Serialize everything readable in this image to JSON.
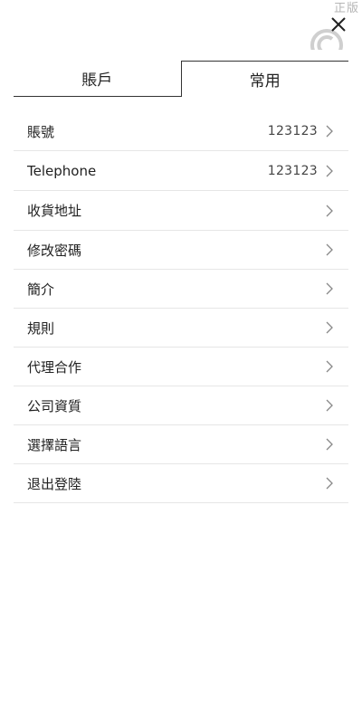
{
  "watermark": {
    "text": "正版"
  },
  "header": {
    "close_icon": "close-icon"
  },
  "tabs": [
    {
      "label": "賬戶",
      "active": false
    },
    {
      "label": "常用",
      "active": true
    }
  ],
  "menu": {
    "items": [
      {
        "label": "賬號",
        "value": "123123"
      },
      {
        "label": "Telephone",
        "value": "123123"
      },
      {
        "label": "收貨地址",
        "value": ""
      },
      {
        "label": "修改密碼",
        "value": ""
      },
      {
        "label": "簡介",
        "value": ""
      },
      {
        "label": "規則",
        "value": ""
      },
      {
        "label": "代理合作",
        "value": ""
      },
      {
        "label": "公司資質",
        "value": ""
      },
      {
        "label": "選擇語言",
        "value": ""
      },
      {
        "label": "退出登陸",
        "value": ""
      }
    ]
  },
  "colors": {
    "text": "#222222",
    "divider": "#e6e6e6",
    "chevron": "#888888",
    "watermark": "#b5b5b5"
  }
}
